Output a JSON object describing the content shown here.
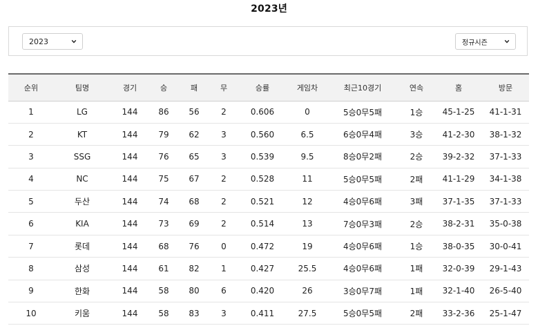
{
  "page": {
    "title": "2023년"
  },
  "filters": {
    "year": {
      "selected": "2023",
      "icon": "chevron-down-icon"
    },
    "season": {
      "selected": "정규시즌",
      "icon": "chevron-down-icon"
    }
  },
  "table": {
    "columns": [
      "순위",
      "팀명",
      "경기",
      "승",
      "패",
      "무",
      "승률",
      "게임차",
      "최근10경기",
      "연속",
      "홈",
      "방문"
    ],
    "rows": [
      [
        "1",
        "LG",
        "144",
        "86",
        "56",
        "2",
        "0.606",
        "0",
        "5승0무5패",
        "1승",
        "45-1-25",
        "41-1-31"
      ],
      [
        "2",
        "KT",
        "144",
        "79",
        "62",
        "3",
        "0.560",
        "6.5",
        "6승0무4패",
        "3승",
        "41-2-30",
        "38-1-32"
      ],
      [
        "3",
        "SSG",
        "144",
        "76",
        "65",
        "3",
        "0.539",
        "9.5",
        "8승0무2패",
        "2승",
        "39-2-32",
        "37-1-33"
      ],
      [
        "4",
        "NC",
        "144",
        "75",
        "67",
        "2",
        "0.528",
        "11",
        "5승0무5패",
        "2패",
        "41-1-29",
        "34-1-38"
      ],
      [
        "5",
        "두산",
        "144",
        "74",
        "68",
        "2",
        "0.521",
        "12",
        "4승0무6패",
        "3패",
        "37-1-35",
        "37-1-33"
      ],
      [
        "6",
        "KIA",
        "144",
        "73",
        "69",
        "2",
        "0.514",
        "13",
        "7승0무3패",
        "2승",
        "38-2-31",
        "35-0-38"
      ],
      [
        "7",
        "롯데",
        "144",
        "68",
        "76",
        "0",
        "0.472",
        "19",
        "4승0무6패",
        "1승",
        "38-0-35",
        "30-0-41"
      ],
      [
        "8",
        "삼성",
        "144",
        "61",
        "82",
        "1",
        "0.427",
        "25.5",
        "4승0무6패",
        "1패",
        "32-0-39",
        "29-1-43"
      ],
      [
        "9",
        "한화",
        "144",
        "58",
        "80",
        "6",
        "0.420",
        "26",
        "3승0무7패",
        "1패",
        "32-1-40",
        "26-5-40"
      ],
      [
        "10",
        "키움",
        "144",
        "58",
        "83",
        "3",
        "0.411",
        "27.5",
        "5승0무5패",
        "2패",
        "33-2-36",
        "25-1-47"
      ]
    ]
  }
}
